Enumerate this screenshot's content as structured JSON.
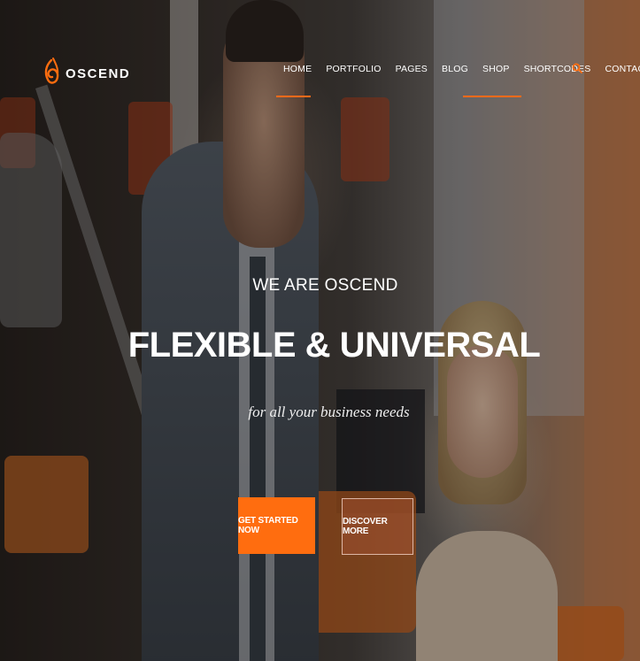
{
  "header": {
    "logo_text": "OSCEND",
    "nav": [
      {
        "label": "HOME",
        "active": true
      },
      {
        "label": "PORTFOLIO"
      },
      {
        "label": "PAGES"
      },
      {
        "label": "BLOG"
      },
      {
        "label": "SHOP"
      },
      {
        "label": "SHORTCODES",
        "active": true
      },
      {
        "label": "CONTACTS"
      }
    ],
    "search_icon": "search-icon"
  },
  "hero": {
    "eyebrow": "WE ARE OSCEND",
    "headline": "FLEXIBLE & UNIVERSAL",
    "tagline": "for all your business needs",
    "primary_button": "GET STARTED NOW",
    "secondary_button": "DISCOVER MORE"
  },
  "colors": {
    "accent": "#ff6d0f",
    "text": "#ffffff"
  }
}
